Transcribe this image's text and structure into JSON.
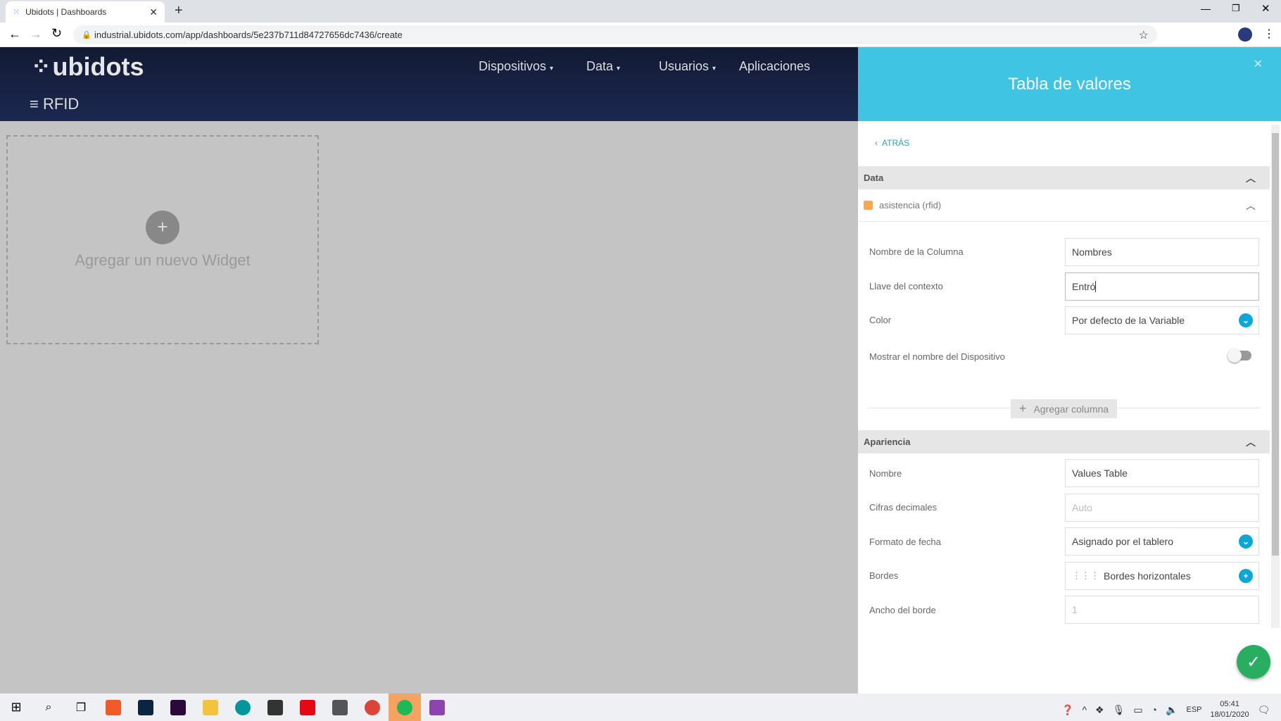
{
  "browser": {
    "tab_title": "Ubidots | Dashboards",
    "url": "industrial.ubidots.com/app/dashboards/5e237b711d84727656dc7436/create"
  },
  "header": {
    "logo": "ubidots",
    "nav": [
      "Dispositivos",
      "Data",
      "Usuarios",
      "Aplicaciones"
    ],
    "dashboard_name": "RFID"
  },
  "canvas": {
    "add_widget_label": "Agregar un nuevo Widget"
  },
  "panel": {
    "title": "Tabla de valores",
    "back_label": "ATRÁS",
    "data_section": "Data",
    "variable": {
      "name": "asistencia (rfid)",
      "color": "#ffa64d"
    },
    "fields": {
      "column_name_label": "Nombre de la Columna",
      "column_name_value": "Nombres",
      "context_key_label": "Llave del contexto",
      "context_key_value": "Entró",
      "color_label": "Color",
      "color_value": "Por defecto de la Variable",
      "show_device_label": "Mostrar el nombre del Dispositivo",
      "show_device_on": false
    },
    "add_column_label": "Agregar columna",
    "appearance_section": "Apariencia",
    "appearance": {
      "name_label": "Nombre",
      "name_value": "Values Table",
      "decimals_label": "Cifras decimales",
      "decimals_placeholder": "Auto",
      "date_format_label": "Formato de fecha",
      "date_format_value": "Asignado por el tablero",
      "borders_label": "Bordes",
      "borders_value": "Bordes horizontales",
      "border_width_label": "Ancho del borde",
      "border_width_placeholder": "1"
    }
  },
  "taskbar": {
    "lang": "ESP",
    "time": "05:41",
    "date": "18/01/2020"
  },
  "colors": {
    "accent": "#40c4e4",
    "header": "#121a33",
    "confirm": "#27ae60"
  }
}
